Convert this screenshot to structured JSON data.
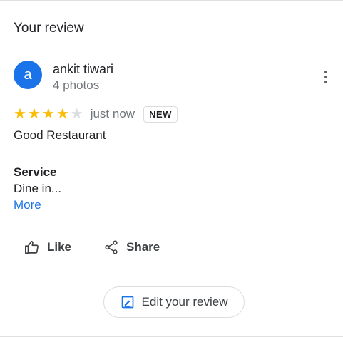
{
  "section": {
    "title": "Your review"
  },
  "author": {
    "avatar_letter": "a",
    "avatar_color": "#1a73e8",
    "name": "ankit tiwari",
    "meta": "4 photos"
  },
  "rating": {
    "value": 4,
    "max": 5,
    "filled_color": "#fbbc04",
    "empty_color": "#dadce0",
    "time": "just now",
    "badge": "NEW"
  },
  "review": {
    "text": "Good Restaurant",
    "attribute_label": "Service",
    "attribute_value": "Dine in...",
    "more_label": "More"
  },
  "actions": {
    "like_label": "Like",
    "share_label": "Share",
    "edit_label": "Edit your review"
  },
  "icons": {
    "like": "thumbs-up-icon",
    "share": "share-icon",
    "edit": "edit-icon",
    "menu": "more-vert-icon",
    "star": "star-icon"
  }
}
